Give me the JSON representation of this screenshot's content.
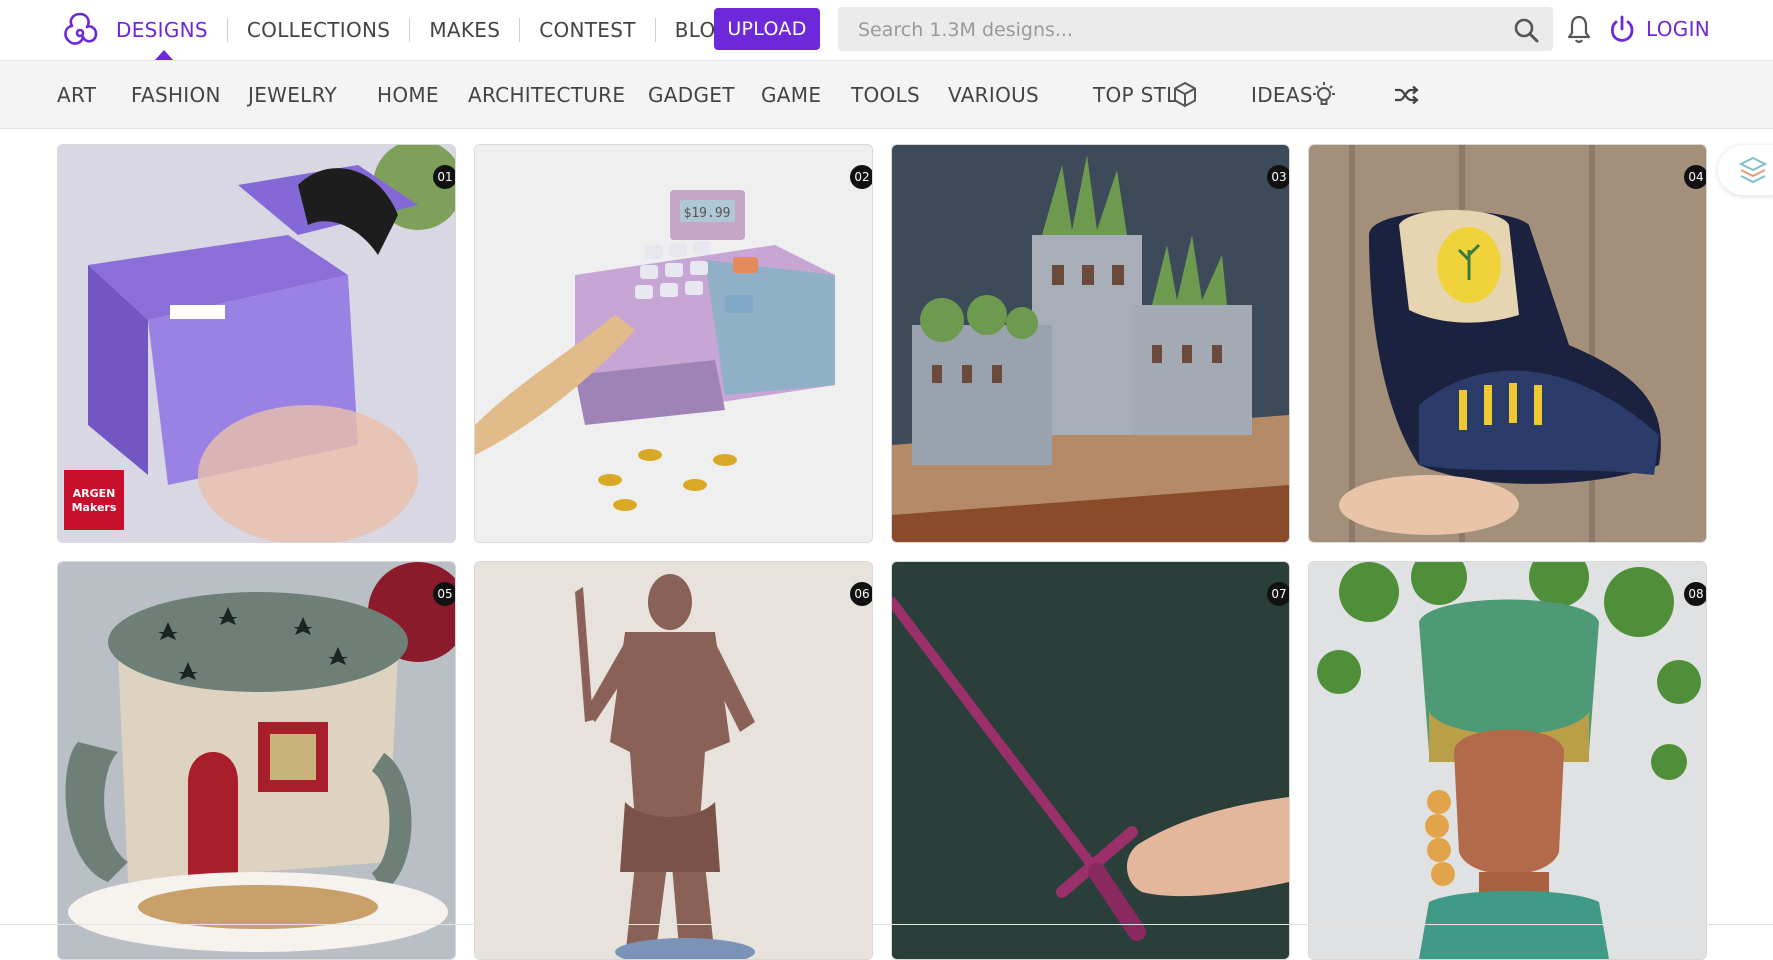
{
  "nav": {
    "items": [
      {
        "label": "DESIGNS",
        "active": true
      },
      {
        "label": "COLLECTIONS"
      },
      {
        "label": "MAKES"
      },
      {
        "label": "CONTEST"
      },
      {
        "label": "BLOG"
      }
    ],
    "upload_label": "UPLOAD",
    "search_placeholder": "Search 1.3M designs...",
    "login_label": "LOGIN",
    "accent_color": "#6d28d9",
    "icons": [
      "logo-icon",
      "search-icon",
      "bell-icon",
      "power-icon"
    ]
  },
  "categories": {
    "items": [
      "ART",
      "FASHION",
      "JEWELRY",
      "HOME",
      "ARCHITECTURE",
      "GADGET",
      "GAME",
      "TOOLS",
      "VARIOUS"
    ],
    "top_stl_label": "TOP STL",
    "ideas_label": "IDEAS",
    "icons": [
      "cube-icon",
      "lightbulb-icon",
      "shuffle-icon"
    ]
  },
  "grid": {
    "cards": [
      {
        "rank": "01",
        "subject": "purple folding organizer",
        "logo_text": "ARGEN Makers"
      },
      {
        "rank": "02",
        "subject": "toy cash register",
        "display_text": "$19.99"
      },
      {
        "rank": "03",
        "subject": "castle planter with succulents"
      },
      {
        "rank": "04",
        "subject": "sneaker planter"
      },
      {
        "rank": "05",
        "subject": "fairy house mug"
      },
      {
        "rank": "06",
        "subject": "warrior figure statue"
      },
      {
        "rank": "07",
        "subject": "pink toy sword"
      },
      {
        "rank": "08",
        "subject": "head planter with plant hair"
      }
    ]
  }
}
